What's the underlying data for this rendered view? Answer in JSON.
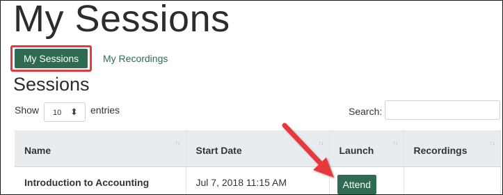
{
  "page": {
    "title": "My Sessions"
  },
  "tabs": [
    {
      "label": "My Sessions",
      "active": true
    },
    {
      "label": "My Recordings",
      "active": false
    }
  ],
  "section": {
    "heading": "Sessions"
  },
  "length_control": {
    "show_label": "Show",
    "value": "10",
    "entries_label": "entries"
  },
  "search": {
    "label": "Search:",
    "value": "",
    "placeholder": ""
  },
  "table": {
    "columns": [
      "Name",
      "Start Date",
      "Launch",
      "Recordings"
    ],
    "rows": [
      {
        "name": "Introduction to Accounting",
        "start_date": "Jul 7, 2018 11:15 AM",
        "launch_label": "Attend",
        "recordings": ""
      }
    ]
  },
  "icons": {
    "sort": "sort-arrows-icon",
    "select_caret": "up-down-caret-icon",
    "annotation": "red-arrow-annotation"
  },
  "colors": {
    "brand_green": "#2e6b52",
    "highlight_red": "#e0393e",
    "header_gray": "#e9ecef"
  }
}
